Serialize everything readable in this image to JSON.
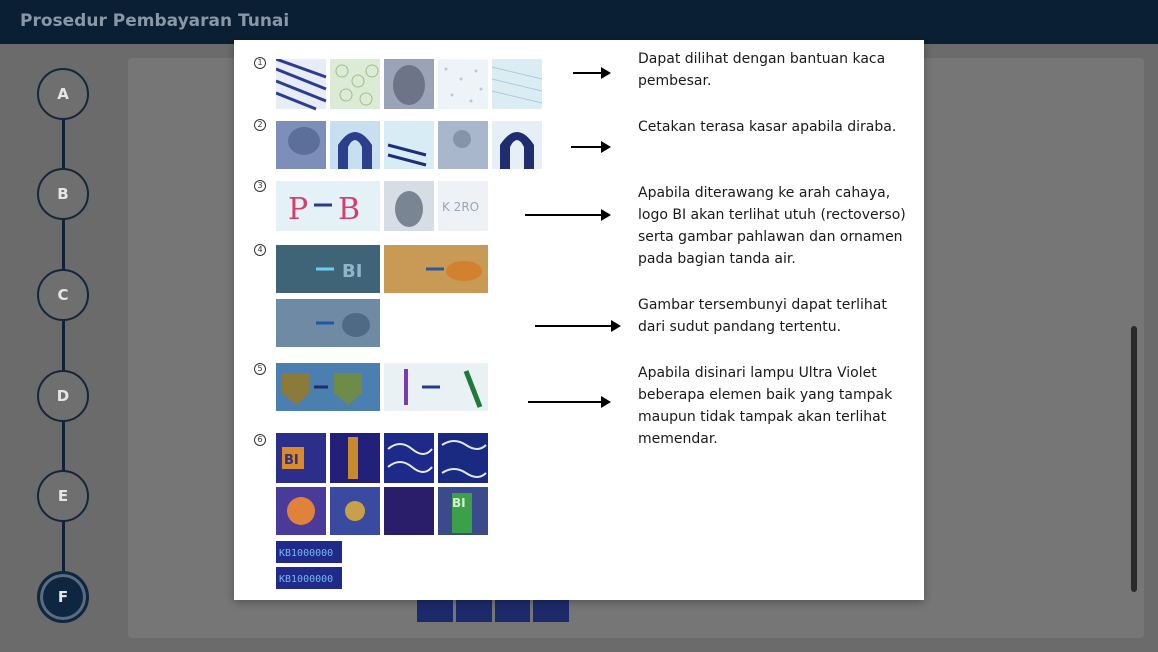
{
  "header": {
    "title": "Prosedur Pembayaran Tunai"
  },
  "stepper": {
    "steps": [
      "A",
      "B",
      "C",
      "D",
      "E",
      "F"
    ],
    "active": "F"
  },
  "modal": {
    "numbers": [
      "1",
      "2",
      "3",
      "4",
      "5",
      "6"
    ],
    "descriptions": [
      "Dapat dilihat dengan bantuan kaca pembesar.",
      "Cetakan terasa kasar apabila diraba.",
      "Apabila diterawang ke arah cahaya, logo BI akan terlihat utuh (rectoverso) serta gambar pahlawan dan ornamen pada bagian tanda air.",
      "Gambar tersembunyi dapat terlihat dari sudut pandang tertentu.",
      "Apabila disinari lampu Ultra Violet beberapa elemen baik yang tampak maupun tidak tampak akan terlihat memendar."
    ],
    "image_text": {
      "bi": "BI",
      "serial": "KB1000000"
    }
  }
}
